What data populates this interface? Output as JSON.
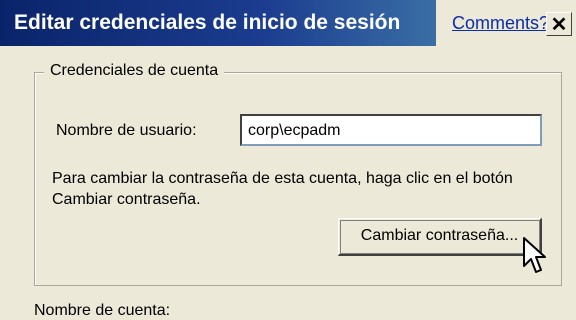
{
  "window": {
    "title": "Editar credenciales de inicio de sesión",
    "comments_link": "Comments?",
    "close_glyph": "✕"
  },
  "group": {
    "legend": "Credenciales de cuenta",
    "username_label": "Nombre de usuario:",
    "username_value": "corp\\ecpadm",
    "info_text": "Para cambiar la contraseña de esta cuenta, haga clic en el botón Cambiar contraseña.",
    "change_password_label": "Cambiar contraseña..."
  },
  "account_name_label": "Nombre de cuenta:",
  "icons": {
    "close": "close-icon",
    "cursor": "mouse-pointer-icon"
  },
  "colors": {
    "titlebar": "#0a246a",
    "window_bg": "#ece9d8",
    "link": "#0b2ea8"
  }
}
